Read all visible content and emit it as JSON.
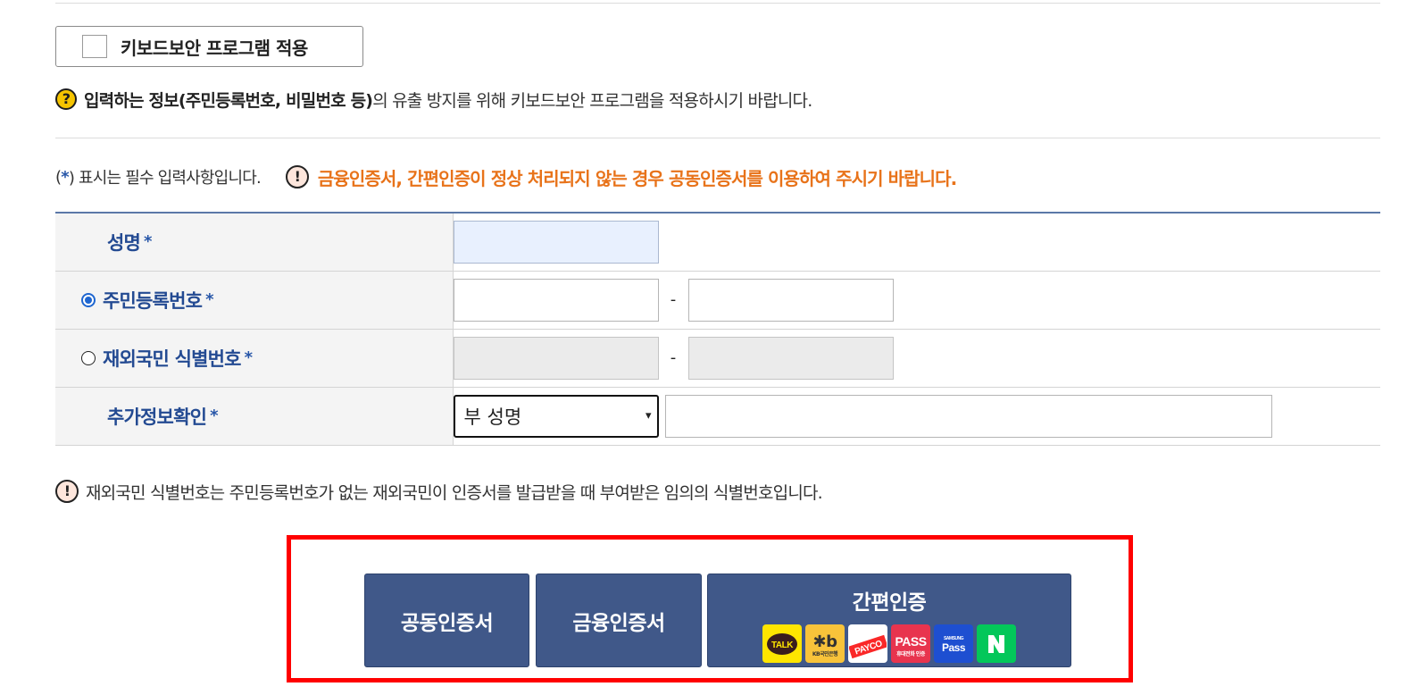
{
  "keyboard_security": {
    "label": "키보드보안 프로그램 적용",
    "checked": false
  },
  "info": {
    "icon": "question-icon",
    "bold_text": "입력하는 정보(주민등록번호, 비밀번호 등)",
    "rest_text": "의 유출 방지를 위해 키보드보안 프로그램을 적용하시기 바랍니다."
  },
  "required_note": {
    "prefix": "(",
    "star": "*",
    "suffix": ") 표시는 필수 입력사항입니다.",
    "warn_icon_text": "!",
    "warning": "금융인증서, 간편인증이 정상 처리되지 않는 경우 공동인증서를 이용하여 주시기 바랍니다."
  },
  "form": {
    "rows": [
      {
        "label": "성명",
        "star": "*"
      },
      {
        "label": "주민등록번호",
        "star": "*",
        "radio_selected": true,
        "separator": "-"
      },
      {
        "label": "재외국민 식별번호",
        "star": "*",
        "radio_selected": false,
        "separator": "-"
      },
      {
        "label": "추가정보확인",
        "star": "*",
        "select_value": "부 성명",
        "select_arrow": "▾"
      }
    ]
  },
  "foreign_note": {
    "icon_text": "!",
    "text": "재외국민 식별번호는 주민등록번호가 없는 재외국민이 인증서를 발급받을 때 부여받은 임의의 식별번호입니다."
  },
  "buttons": {
    "joint_cert": "공동인증서",
    "financial_cert": "금융인증서",
    "simple_auth": "간편인증",
    "simple_auth_providers": [
      {
        "name": "kakao-talk-icon",
        "text": "TALK",
        "bg": "#fee500",
        "fg": "#3a1d1d"
      },
      {
        "name": "kb-bank-icon",
        "text": "KB국민은행",
        "bg": "#f8c33a",
        "fg": "#333333"
      },
      {
        "name": "payco-icon",
        "text": "PAYCO",
        "bg": "#ffffff",
        "fg": "#fa2828"
      },
      {
        "name": "pass-icon",
        "text": "PASS",
        "bg": "#e8344e",
        "fg": "#ffffff"
      },
      {
        "name": "samsung-pass-icon",
        "text": "Pass",
        "bg": "#1e4fd1",
        "fg": "#ffffff"
      },
      {
        "name": "naver-icon",
        "text": "N",
        "bg": "#03c75a",
        "fg": "#ffffff"
      }
    ]
  },
  "colors": {
    "accent_blue": "#234a92",
    "warning_orange": "#e8731a",
    "button_bg": "#405889",
    "highlight_red": "#ff0000"
  }
}
